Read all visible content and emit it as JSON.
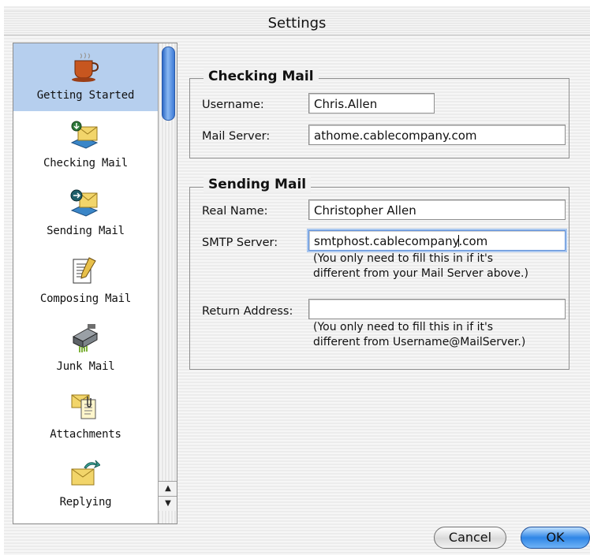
{
  "window": {
    "title": "Settings"
  },
  "sidebar": {
    "items": [
      {
        "label": "Getting Started",
        "icon": "coffee-cup-icon",
        "selected": true
      },
      {
        "label": "Checking Mail",
        "icon": "mail-download-icon",
        "selected": false
      },
      {
        "label": "Sending Mail",
        "icon": "mail-upload-icon",
        "selected": false
      },
      {
        "label": "Composing Mail",
        "icon": "document-pencil-icon",
        "selected": false
      },
      {
        "label": "Junk Mail",
        "icon": "shredder-icon",
        "selected": false
      },
      {
        "label": "Attachments",
        "icon": "attachment-envelope-icon",
        "selected": false
      },
      {
        "label": "Replying",
        "icon": "reply-envelope-icon",
        "selected": false
      }
    ]
  },
  "checking_mail": {
    "title": "Checking Mail",
    "username_label": "Username:",
    "username_value": "Chris.Allen",
    "server_label": "Mail Server:",
    "server_value": "athome.cablecompany.com"
  },
  "sending_mail": {
    "title": "Sending Mail",
    "real_name_label": "Real Name:",
    "real_name_value": "Christopher Allen",
    "smtp_label": "SMTP Server:",
    "smtp_value_before_caret": "smtphost.cablecompany",
    "smtp_value_after_caret": ".com",
    "smtp_help_line1": "(You only need to fill this in if it's",
    "smtp_help_line2": "different from your Mail Server above.)",
    "return_label": "Return Address:",
    "return_value": "",
    "return_help_line1": "(You only need to fill this in if it's",
    "return_help_line2": "different from Username@MailServer.)"
  },
  "buttons": {
    "cancel": "Cancel",
    "ok": "OK"
  },
  "colors": {
    "selection": "#b6cfee",
    "aqua_blue": "#2f86e6",
    "heading_blue": "#1a7fd0"
  }
}
